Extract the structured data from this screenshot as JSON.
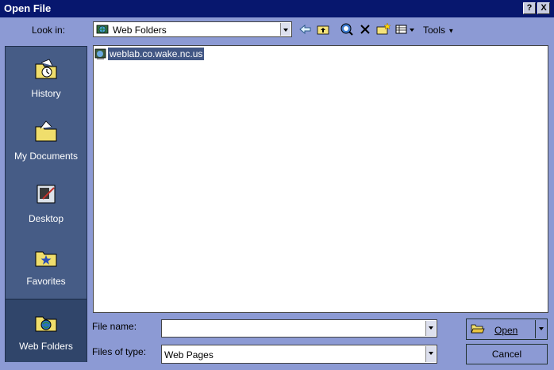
{
  "window": {
    "title": "Open File",
    "help_button": "?",
    "close_button": "X"
  },
  "lookin": {
    "label": "Look in:",
    "value": "Web Folders"
  },
  "toolbar": {
    "tools_label": "Tools"
  },
  "places": [
    {
      "label": "History"
    },
    {
      "label": "My Documents"
    },
    {
      "label": "Desktop"
    },
    {
      "label": "Favorites"
    },
    {
      "label": "Web Folders"
    }
  ],
  "files": [
    {
      "name": "weblab.co.wake.nc.us"
    }
  ],
  "filename": {
    "label": "File name:",
    "value": ""
  },
  "filetype": {
    "label": "Files of type:",
    "value": "Web Pages"
  },
  "buttons": {
    "open_label": "Open",
    "cancel_label": "Cancel"
  }
}
